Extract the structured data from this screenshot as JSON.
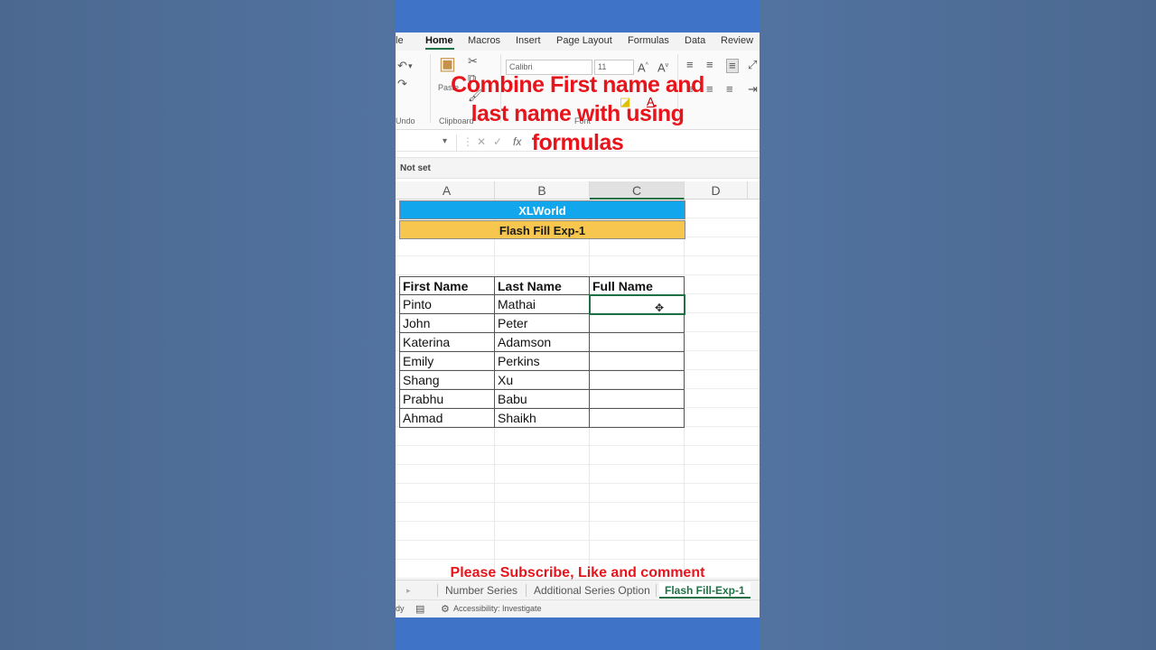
{
  "menu": {
    "items": [
      "le",
      "Home",
      "Macros",
      "Insert",
      "Page Layout",
      "Formulas",
      "Data",
      "Review"
    ]
  },
  "ribbon": {
    "font_name": "Calibri",
    "font_size": "11",
    "group_undo": "Undo",
    "group_clipboard": "Clipboard",
    "group_font": "Font",
    "paste_label": "Paste"
  },
  "formula_bar": {
    "fx_label": "fx",
    "cancel_symbol": "✕",
    "enter_symbol": "✓"
  },
  "status_line": "Not set",
  "columns": [
    "A",
    "B",
    "C",
    "D"
  ],
  "sheet": {
    "title": "XLWorld",
    "subtitle": "Flash Fill Exp-1",
    "headers": [
      "First Name",
      "Last Name",
      "Full Name"
    ],
    "rows": [
      [
        "Pinto",
        "Mathai",
        ""
      ],
      [
        "John",
        "Peter",
        ""
      ],
      [
        "Katerina",
        "Adamson",
        ""
      ],
      [
        "Emily",
        "Perkins",
        ""
      ],
      [
        "Shang",
        "Xu",
        ""
      ],
      [
        "Prabhu",
        "Babu",
        ""
      ],
      [
        "Ahmad",
        "Shaikh",
        ""
      ]
    ]
  },
  "sheet_tabs": {
    "items": [
      "Number Series",
      "Additional Series Option",
      "Flash Fill-Exp-1"
    ],
    "active": "Flash Fill-Exp-1"
  },
  "status_bar": {
    "ready": "dy",
    "accessibility": "Accessibility: Investigate"
  },
  "overlay": {
    "title_line1": "Combine First name and",
    "title_line2": "last name with using",
    "title_line3": "formulas",
    "subscribe": "Please Subscribe, Like and comment"
  },
  "colors": {
    "title_band": "#12a7ec",
    "subtitle_band": "#f7c64f",
    "excel_green": "#1f7145",
    "overlay_red": "#e8141b"
  }
}
